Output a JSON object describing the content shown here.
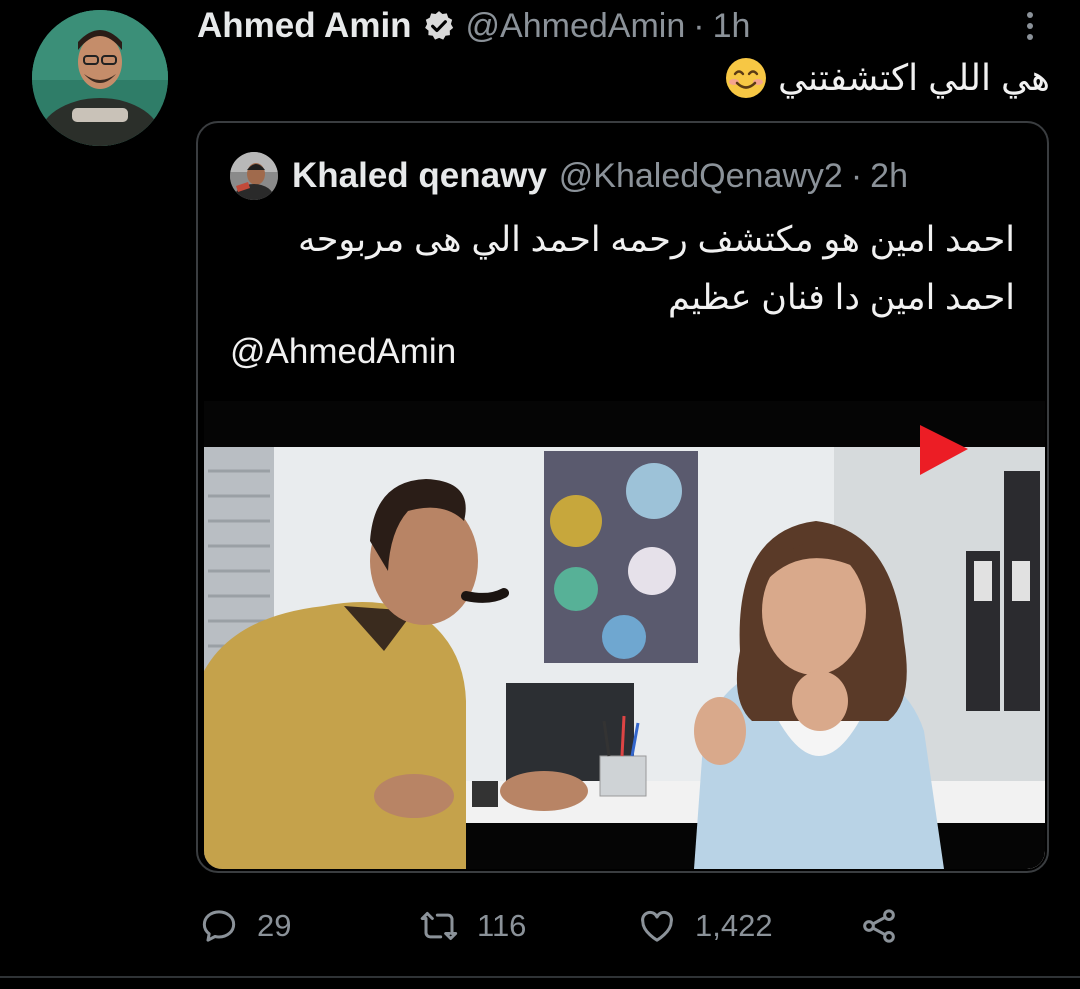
{
  "author": {
    "name": "Ahmed Amin",
    "handle": "@AhmedAmin",
    "time": "1h",
    "verified": true,
    "avatar_icon": "avatar-photo"
  },
  "tweet_text": "هي اللي اكتشفتني",
  "emoji": "smiling-face-icon",
  "quoted": {
    "name": "Khaled qenawy",
    "handle": "@KhaledQenawy2",
    "time": "2h",
    "lines": [
      "احمد امين هو مكتشف رحمه احمد الي هى مربوحه",
      "احمد امين دا فنان عظيم"
    ],
    "mention": "@AhmedAmin"
  },
  "actions": {
    "replies": "29",
    "retweets": "116",
    "likes": "1,422"
  },
  "separator": "·",
  "colors": {
    "background": "#000000",
    "text": "#e7e9ea",
    "muted": "#8b9299",
    "border": "#3a3d40"
  }
}
